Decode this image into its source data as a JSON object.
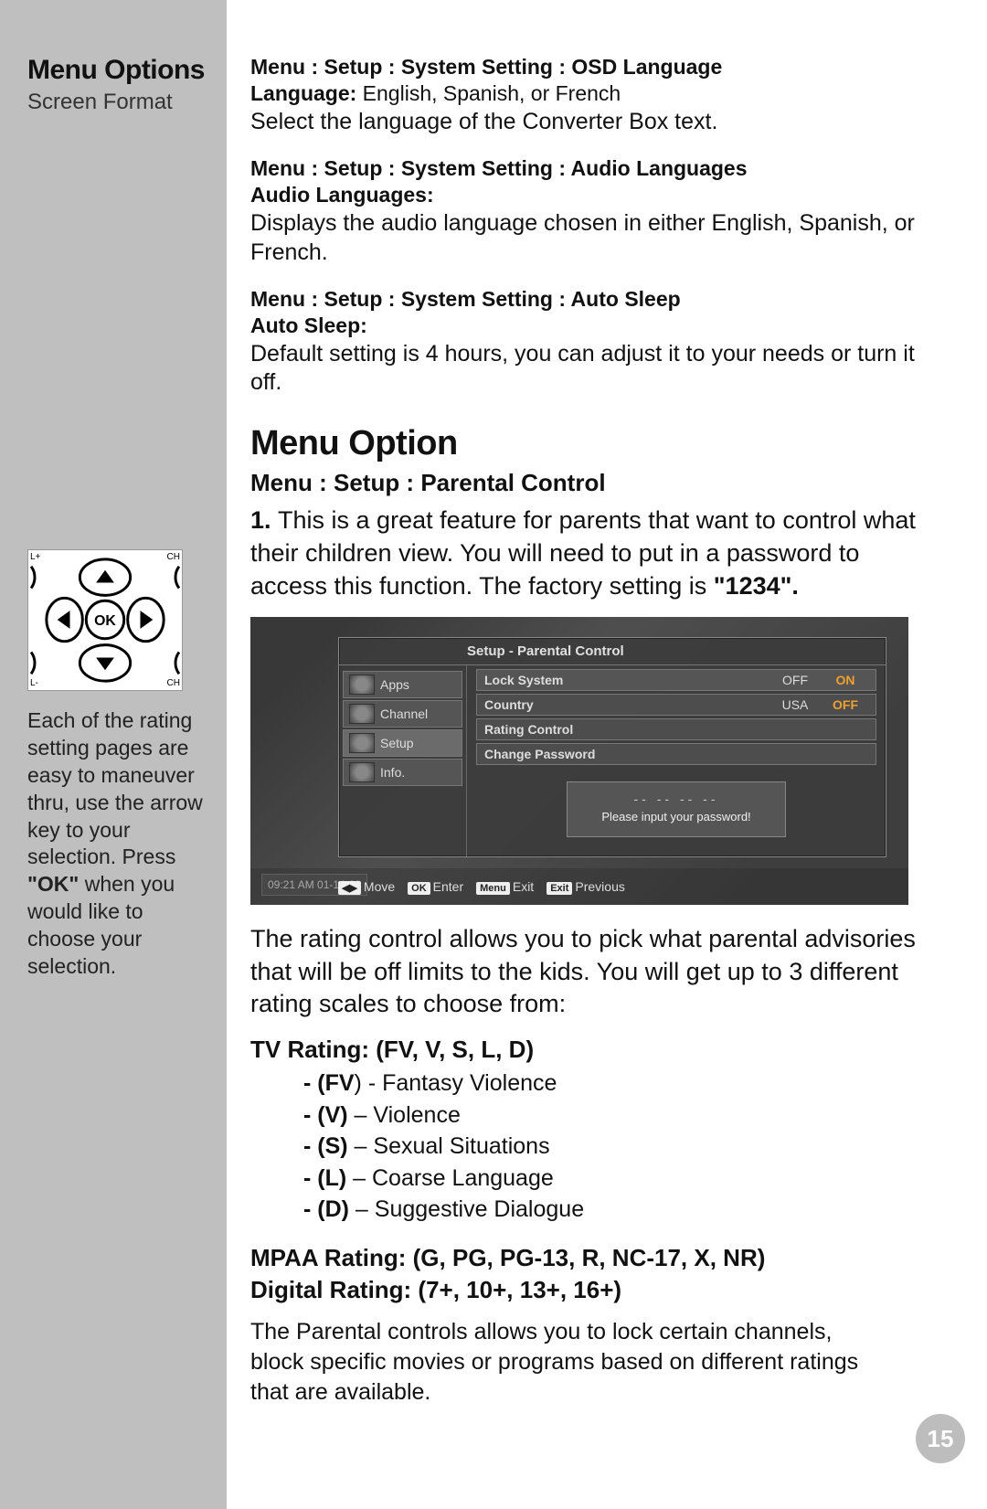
{
  "sidebar": {
    "title": "Menu Options",
    "subtitle": "Screen Format",
    "remote": {
      "ok": "OK",
      "tl": "L+",
      "tr": "CH",
      "bl": "L-",
      "br": "CH"
    },
    "note_pre": "Each of the rating setting pages are easy to maneuver thru, use the arrow key to your selection. Press ",
    "note_bold": "\"OK\"",
    "note_post": " when you would like to choose your selection."
  },
  "sections": [
    {
      "crumb": "Menu  :  Setup  :  System Setting  :  OSD Language",
      "label_bold": "Language:",
      "label_rest": " English, Spanish, or French",
      "body": "Select the language of the Converter Box text."
    },
    {
      "crumb": "Menu  :  Setup  :  System Setting  :  Audio Languages",
      "label_bold": "Audio Languages:",
      "label_rest": "",
      "body": "Displays the audio language chosen in either English, Spanish, or French."
    },
    {
      "crumb": "Menu  :  Setup  :  System Setting  :  Auto Sleep",
      "label_bold": "Auto Sleep:",
      "label_rest": "",
      "body": "Default setting is 4 hours, you can adjust it to your needs or turn it off."
    }
  ],
  "menuOption": {
    "heading": "Menu Option",
    "crumb": "Menu  :  Setup  :  Parental Control",
    "intro_num": "1. ",
    "intro_body": "This is a great feature for parents that want to control what their children view. You will need to put in a password to access this function. The factory setting is ",
    "intro_bold": "\"1234\"."
  },
  "osd": {
    "title": "Setup - Parental Control",
    "menuItems": [
      "Apps",
      "Channel",
      "Setup",
      "Info."
    ],
    "rows": [
      {
        "k": "Lock System",
        "v": "OFF ",
        "v2": "ON"
      },
      {
        "k": "Country",
        "v": "USA",
        "v2": "OFF"
      },
      {
        "k": "Rating Control",
        "v": "",
        "v2": ""
      },
      {
        "k": "Change Password",
        "v": "",
        "v2": ""
      }
    ],
    "pwbox_dots": "-- -- -- --",
    "pwbox_msg": "Please input your password!",
    "time": "09:21 AM 01-14-08",
    "hints": [
      {
        "key": "◀▶",
        "label": "Move"
      },
      {
        "key": "OK",
        "label": "Enter"
      },
      {
        "key": "Menu",
        "label": "Exit"
      },
      {
        "key": "Exit",
        "label": "Previous"
      }
    ]
  },
  "ratingIntro": "The rating control allows you to pick what parental advisories that will be off limits to the kids. You will get up to 3 different rating scales to choose from:",
  "tvRating": {
    "head": "TV Rating: (FV, V, S, L, D)",
    "items": [
      {
        "b": "- (FV",
        "rest": ") - Fantasy Violence"
      },
      {
        "b": "- (V)",
        "rest": " – Violence"
      },
      {
        "b": "- (S)",
        "rest": " – Sexual Situations"
      },
      {
        "b": "- (L)",
        "rest": " – Coarse Language"
      },
      {
        "b": "- (D)",
        "rest": " – Suggestive Dialogue"
      }
    ]
  },
  "mpaa": "MPAA Rating: (G, PG, PG-13, R, NC-17, X, NR)",
  "digital": "Digital Rating: (7+, 10+, 13+, 16+)",
  "closing": "The Parental controls allows you to lock certain channels, block specific movies or programs based on different ratings that are available.",
  "pageNum": "15"
}
